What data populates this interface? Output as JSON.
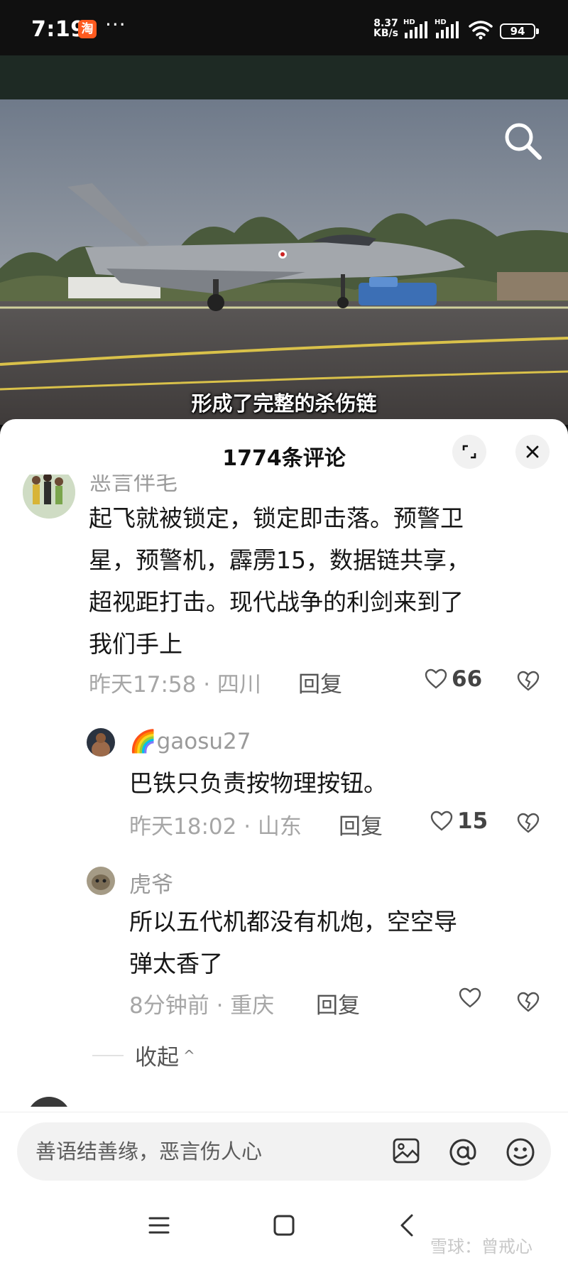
{
  "status_bar": {
    "time": "7:19",
    "app_badge": "淘",
    "more": "···",
    "net_speed_value": "8.37",
    "net_speed_unit": "KB/s",
    "signal_label": "HD",
    "battery": "94"
  },
  "video": {
    "subtitle": "形成了完整的杀伤链"
  },
  "comments_panel": {
    "title": "1774条评论",
    "comments": [
      {
        "username": "恶言伴毛",
        "text_lines": [
          "起飞就被锁定，锁定即击落。预警卫",
          "星，预警机，霹雳15，数据链共享，",
          "超视距打击。现代战争的利剑来到了",
          "我们手上"
        ],
        "meta": "昨天17:58 · 四川",
        "reply": "回复",
        "likes": "66",
        "replies": [
          {
            "badge": "🌈",
            "username": "gaosu27",
            "text_lines": [
              "巴铁只负责按物理按钮。"
            ],
            "meta": "昨天18:02 · 山东",
            "reply": "回复",
            "likes": "15"
          },
          {
            "username": "虎爷",
            "text_lines": [
              "所以五代机都没有机炮，空空导",
              "弹太香了"
            ],
            "meta": "8分钟前 · 重庆",
            "reply": "回复",
            "likes": ""
          }
        ],
        "collapse": "收起",
        "collapse_arrow": "^"
      }
    ]
  },
  "input_bar": {
    "placeholder": "善语结善缘，恶言伤人心"
  },
  "watermark": "雪球：曾戒心",
  "icons": {
    "search": "search-icon",
    "expand": "expand-icon",
    "close": "close-icon",
    "like": "heart-icon",
    "dislike": "broken-heart-icon",
    "image": "image-icon",
    "mention": "at-icon",
    "emoji": "emoji-icon",
    "nav_menu": "menu-icon",
    "nav_home": "home-icon",
    "nav_back": "back-icon"
  }
}
